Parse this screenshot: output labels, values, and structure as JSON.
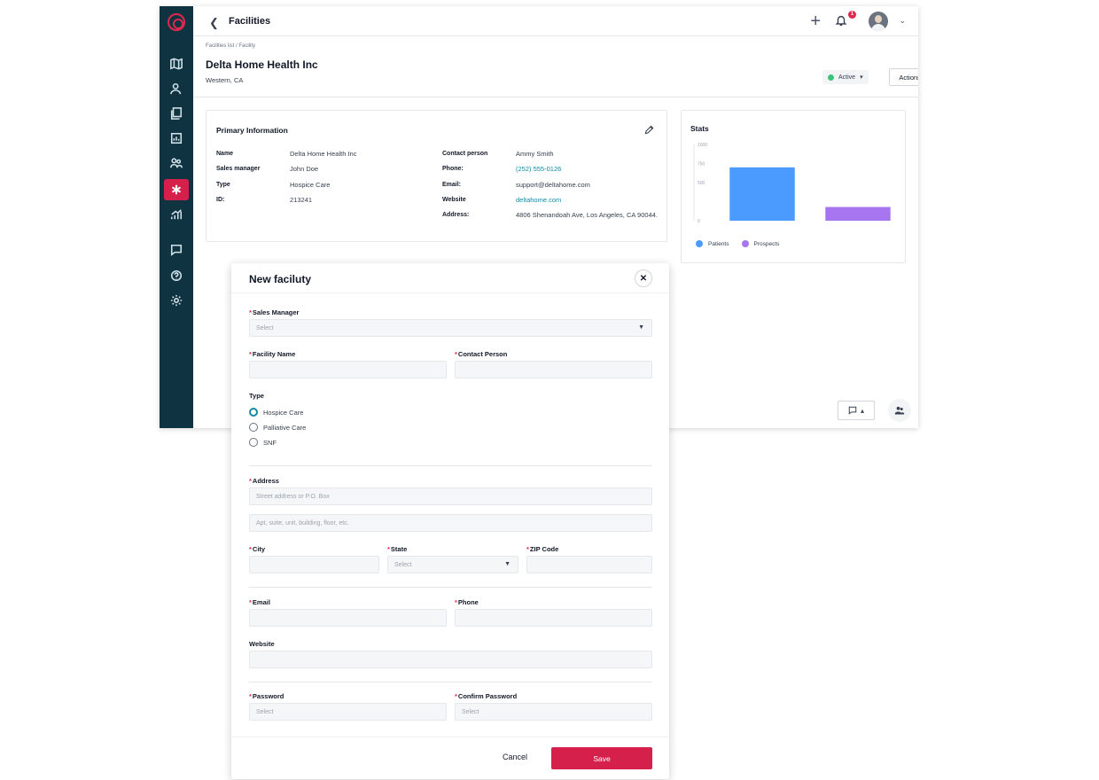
{
  "topbar": {
    "back_icon": "chevron-left-icon",
    "title": "Facilities",
    "notification_count": "1"
  },
  "header": {
    "breadcrumb": "Facilities list / Facility",
    "facility_name": "Delta Home Health Inc",
    "location": "Western, CA",
    "status": "Active",
    "status_color": "#3cc47c",
    "actions_label": "Actions"
  },
  "primary_info": {
    "title": "Primary Information",
    "name_label": "Name",
    "name_value": "Delta Home Health Inc",
    "sales_manager_label": "Sales manager",
    "sales_manager_value": "John Doe",
    "type_label": "Type",
    "type_value": "Hospice Care",
    "id_label": "ID:",
    "id_value": "213241",
    "contact_label": "Contact person",
    "contact_value": "Ammy Smith",
    "phone_label": "Phone:",
    "phone_value": "(252) 555-0126",
    "email_label": "Email:",
    "email_value": "support@deltahome.com",
    "website_label": "Website",
    "website_value": "deltahome.com",
    "address_label": "Address:",
    "address_value": "4806 Shenandoah Ave, Los Angeles, CA 90044."
  },
  "stats": {
    "title": "Stats"
  },
  "chart_data": {
    "type": "bar",
    "categories": [
      "Patients",
      "Prospects"
    ],
    "series": [
      {
        "name": "Patients",
        "values": [
          700
        ],
        "color": "#4b9bff"
      },
      {
        "name": "Prospects",
        "values": [
          180
        ],
        "color": "#a875f0"
      }
    ],
    "y_ticks": [
      "1000",
      "750",
      "500",
      "0"
    ],
    "ylim": [
      0,
      1000
    ],
    "legend": [
      "Patients",
      "Prospects"
    ],
    "legend_position": "bottom-left"
  },
  "modal": {
    "title": "New faciluty",
    "sales_manager_label": "Sales Manager",
    "sales_manager_placeholder": "Select",
    "facility_name_label": "Facility Name",
    "contact_person_label": "Contact Person",
    "type_label": "Type",
    "type_options": [
      "Hospice Care",
      "Palliative Care",
      "SNF"
    ],
    "type_selected": "Hospice Care",
    "address_label": "Address",
    "address_line1_placeholder": "Street address or P.O. Box",
    "address_line2_placeholder": "Apt, suite, unit, building, floor, etc.",
    "city_label": "City",
    "state_label": "State",
    "state_placeholder": "Select",
    "zip_label": "ZIP Code",
    "email_label": "Email",
    "phone_label": "Phone",
    "website_label": "Website",
    "password_label": "Password",
    "password_placeholder": "Select",
    "confirm_password_label": "Confirm Password",
    "confirm_password_placeholder": "Select",
    "cancel_label": "Cancel",
    "save_label": "Save",
    "accent_color": "#d6204c"
  }
}
